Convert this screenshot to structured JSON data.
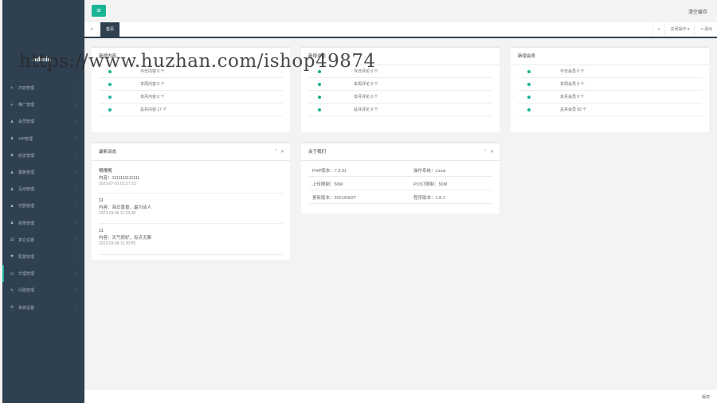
{
  "sidebar": {
    "username": "admin",
    "items": [
      {
        "icon": "✎",
        "icon_name": "edit-icon",
        "label": "内容管理"
      },
      {
        "icon": "✔",
        "icon_name": "check-icon",
        "label": "推广管理"
      },
      {
        "icon": "♟",
        "icon_name": "user-icon",
        "label": "会员管理"
      },
      {
        "icon": "♟",
        "icon_name": "user-icon",
        "label": "VIP管理"
      },
      {
        "icon": "♟",
        "icon_name": "user-icon",
        "label": "收支管理"
      },
      {
        "icon": "♟",
        "icon_name": "user-icon",
        "label": "模板管理"
      },
      {
        "icon": "♟",
        "icon_name": "user-icon",
        "label": "互动管理"
      },
      {
        "icon": "♟",
        "icon_name": "user-icon",
        "label": "付费管理"
      },
      {
        "icon": "♟",
        "icon_name": "user-icon",
        "label": "权限管理"
      },
      {
        "icon": "▤",
        "icon_name": "list-icon",
        "label": "其它设置"
      },
      {
        "icon": "✱",
        "icon_name": "cog-icon",
        "label": "配置管理"
      },
      {
        "icon": "⇄",
        "icon_name": "exchange-icon",
        "label": "代理管理"
      },
      {
        "icon": "✎",
        "icon_name": "edit-icon",
        "label": "问题管理"
      },
      {
        "icon": "⚙",
        "icon_name": "gears-icon",
        "label": "系统设置"
      }
    ]
  },
  "topbar": {
    "menu_icon": "≡",
    "clear_cache": "清空缓存"
  },
  "tabs": {
    "nav_left": "«",
    "home": "首页",
    "nav_right": "»",
    "close_ops": "关闭操作",
    "logout": "退出"
  },
  "watermark": "https://www.huzhan.com/ishop49874",
  "panels": {
    "content": {
      "title": "新增内容",
      "rows": [
        "今日内容 0 个",
        "本周内容 0 个",
        "本月内容 0 个",
        "总共内容 17 个"
      ]
    },
    "comments": {
      "title": "新增评论",
      "rows": [
        "今日评论 0 个",
        "本周评论 0 个",
        "本月评论 0 个",
        "总共评论 9 个"
      ]
    },
    "members": {
      "title": "新增会员",
      "rows": [
        "今日会员 0 个",
        "本周会员 0 个",
        "本月会员 0 个",
        "总共会员 93 个"
      ]
    },
    "news": {
      "title": "最新动态",
      "items": [
        {
          "title": "哦哦哦",
          "content": "内容：1111111111111",
          "date": "2023-07-01 01:27:23"
        },
        {
          "title": "11",
          "content": "内容：海日黄昏，最为动人",
          "date": "2023-03-08 11:33:38"
        },
        {
          "title": "11",
          "content": "内容：天气很好，有点无聊",
          "date": "2023-03-08 11:30:55"
        }
      ]
    },
    "about": {
      "title": "关于我们",
      "rows": [
        [
          "PHP版本：7.3.31",
          "操作系统：Linux"
        ],
        [
          "上传限制：50M",
          "POST限制：50M"
        ],
        [
          "更新版本：2021/09/27",
          "程序版本：1.8.1"
        ]
      ]
    }
  },
  "footer": {
    "text": "版权"
  },
  "colors": {
    "sidebar_bg": "#2f4050",
    "accent": "#1ab394"
  }
}
